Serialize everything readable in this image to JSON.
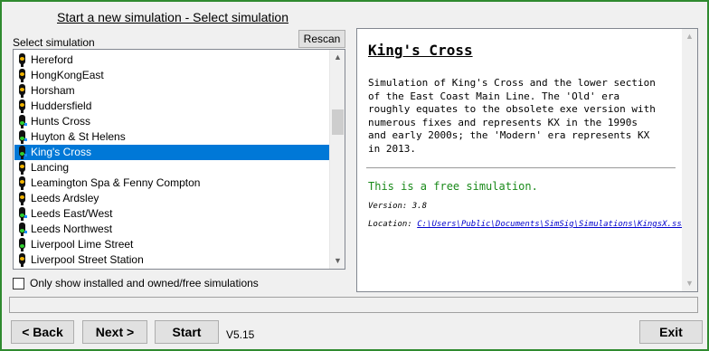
{
  "header": {
    "title": "Start a new simulation - Select simulation"
  },
  "list": {
    "label": "Select simulation",
    "rescan_label": "Rescan",
    "selected_index": 6,
    "items": [
      {
        "label": "Hereford",
        "signal": "yellow"
      },
      {
        "label": "HongKongEast",
        "signal": "yellow"
      },
      {
        "label": "Horsham",
        "signal": "yellow"
      },
      {
        "label": "Huddersfield",
        "signal": "yellow"
      },
      {
        "label": "Hunts Cross",
        "signal": "green",
        "plus": true
      },
      {
        "label": "Huyton & St Helens",
        "signal": "green",
        "plus": true
      },
      {
        "label": "King's Cross",
        "signal": "green",
        "plus": true
      },
      {
        "label": "Lancing",
        "signal": "yellow"
      },
      {
        "label": "Leamington Spa & Fenny Compton",
        "signal": "yellow"
      },
      {
        "label": "Leeds Ardsley",
        "signal": "yellow"
      },
      {
        "label": "Leeds East/West",
        "signal": "green",
        "plus": true
      },
      {
        "label": "Leeds Northwest",
        "signal": "green",
        "plus": true
      },
      {
        "label": "Liverpool Lime Street",
        "signal": "green"
      },
      {
        "label": "Liverpool Street Station",
        "signal": "yellow"
      }
    ],
    "scroll_up_icon": "up-arrow",
    "scroll_down_icon": "down-arrow"
  },
  "filter": {
    "label": "Only show installed and owned/free simulations",
    "checked": false
  },
  "detail": {
    "title": "King's Cross",
    "description": "Simulation of King's Cross and the lower section\nof the East Coast Main Line. The 'Old' era\nroughly equates to the obsolete exe version with\nnumerous fixes and represents KX in the 1990s\nand early 2000s; the 'Modern' era represents KX\nin 2013.",
    "free_text": "This is a free simulation.",
    "version_text": "Version: 3.8",
    "location_label": "Location:",
    "location_path": "C:\\Users\\Public\\Documents\\SimSig\\Simulations\\KingsX.ssm"
  },
  "status": {
    "text": ""
  },
  "buttons": {
    "back": "< Back",
    "next": "Next >",
    "start": "Start",
    "exit": "Exit"
  },
  "version": "V5.15",
  "colors": {
    "selection": "#0078d7",
    "border": "#2f8a2f",
    "free_text": "#1a8a1a",
    "signal_yellow": "#f2b400",
    "signal_green": "#2fd12f"
  }
}
